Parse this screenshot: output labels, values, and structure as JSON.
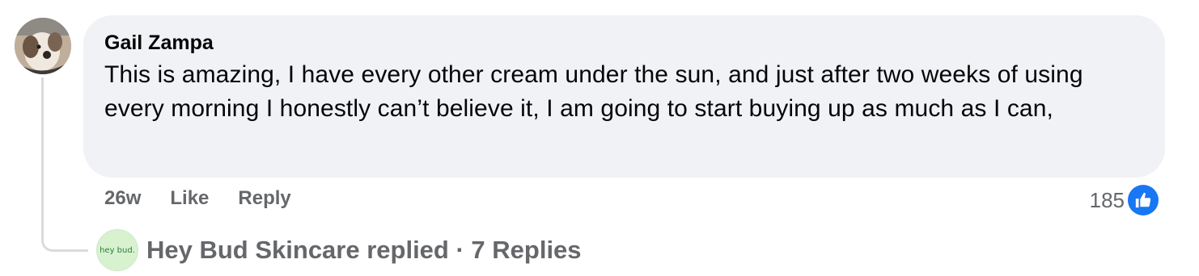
{
  "comment": {
    "author": "Gail Zampa",
    "text": "This is amazing, I have every other cream under the sun, and just after two weeks of using every morning I honestly can’t believe it, I am going to start buying up as much as I can,",
    "time": "26w",
    "like_label": "Like",
    "reply_label": "Reply",
    "reaction_count": "185",
    "reaction_icon": "like-thumb-icon",
    "colors": {
      "bubble": "#f0f2f5",
      "secondary_text": "#65676b",
      "like_blue": "#1877f2"
    }
  },
  "replies": {
    "avatar_text": "hey bud.",
    "summary": "Hey Bud Skincare replied · 7 Replies"
  }
}
